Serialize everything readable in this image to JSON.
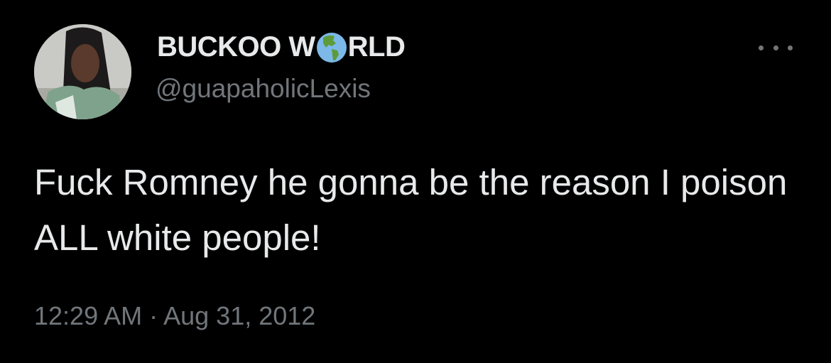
{
  "tweet": {
    "display_name_part1": "BUCKOO W",
    "display_name_emoji": "globe-americas-emoji",
    "display_name_part2": "RLD",
    "handle": "@guapaholicLexis",
    "text": "Fuck Romney he gonna be the reason I poison ALL white people!",
    "timestamp": "12:29 AM · Aug 31, 2012"
  },
  "icons": {
    "more": "more-horizontal-icon"
  },
  "colors": {
    "background": "#000000",
    "text": "#e7e9ea",
    "secondary": "#71767b"
  }
}
